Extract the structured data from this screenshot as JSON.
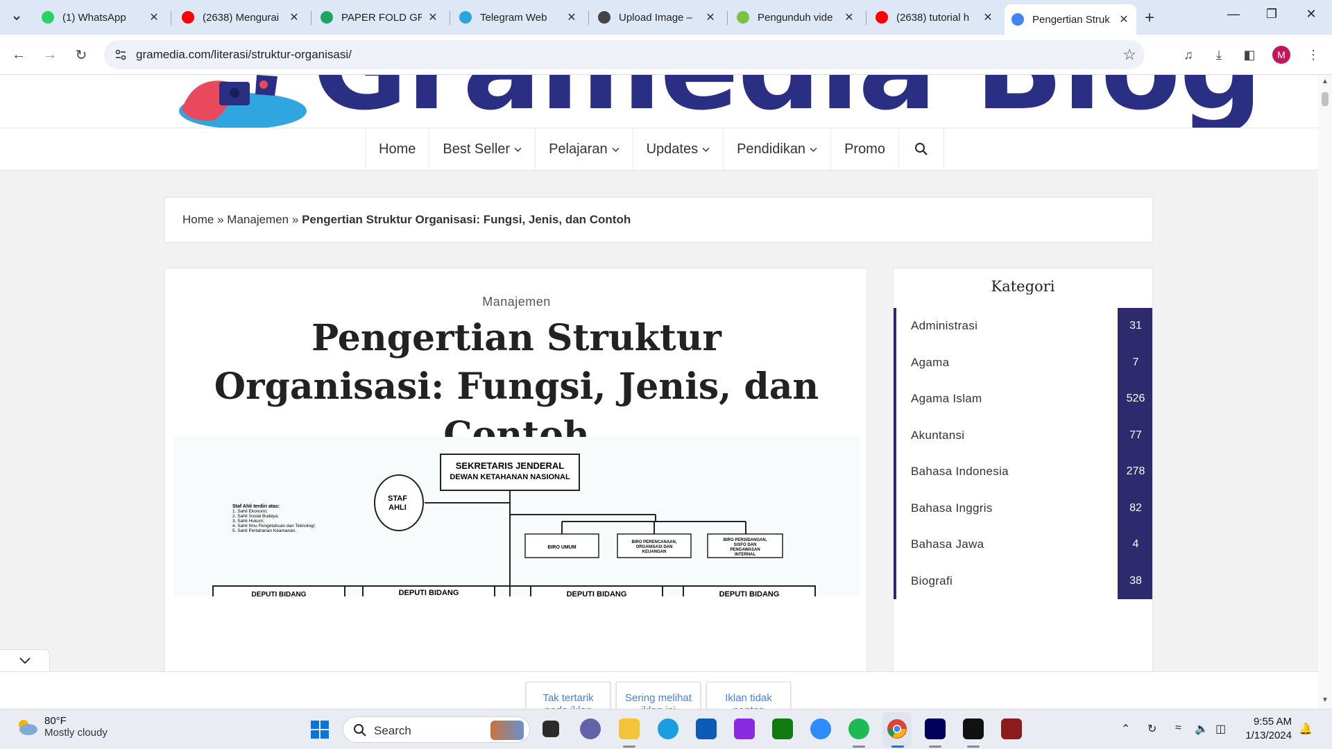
{
  "browser": {
    "tabs": [
      {
        "title": "(1) WhatsApp",
        "favicon": "whatsapp-icon",
        "color": "#25d366"
      },
      {
        "title": "(2638) Mengurai",
        "favicon": "youtube-icon",
        "color": "#ff0000"
      },
      {
        "title": "PAPER FOLD GRE",
        "favicon": "google-drive-icon",
        "color": "#1fa463"
      },
      {
        "title": "Telegram Web",
        "favicon": "telegram-icon",
        "color": "#2aa3df"
      },
      {
        "title": "Upload Image –",
        "favicon": "upload-icon",
        "color": "#444444"
      },
      {
        "title": "Pengunduh vide",
        "favicon": "download-arrow-icon",
        "color": "#7cc142"
      },
      {
        "title": "(2638) tutorial h",
        "favicon": "youtube-icon",
        "color": "#ff0000"
      },
      {
        "title": "Pengertian Struk",
        "favicon": "google-icon",
        "color": "#4285f4",
        "active": true
      }
    ],
    "url": "gramedia.com/literasi/struktur-organisasi/",
    "profile_initial": "M"
  },
  "site": {
    "logo_text": "Gramedia Blog",
    "nav": [
      {
        "label": "Home",
        "dropdown": false
      },
      {
        "label": "Best Seller",
        "dropdown": true
      },
      {
        "label": "Pelajaran",
        "dropdown": true
      },
      {
        "label": "Updates",
        "dropdown": true
      },
      {
        "label": "Pendidikan",
        "dropdown": true
      },
      {
        "label": "Promo",
        "dropdown": false
      }
    ],
    "breadcrumb": {
      "home": "Home",
      "sep": "»",
      "category": "Manajemen",
      "current": "Pengertian Struktur Organisasi: Fungsi, Jenis, dan Contoh"
    },
    "article": {
      "category": "Manajemen",
      "title": "Pengertian Struktur Organisasi: Fungsi, Jenis, dan Contoh",
      "orgchart": {
        "top": "SEKRETARIS JENDERAL\nDEWAN KETAHANAN NASIONAL",
        "staf": "STAF AHLI",
        "staf_list_title": "Staf Ahli terdiri atas:",
        "staf_list": [
          "Sahli Ekonomi;",
          "Sahli Sosial Budaya;",
          "Sahli Hukum;",
          "Sahli Ilmu Pengetahuan dan Teknologi;",
          "Sahli Pertahanan Keamanan."
        ],
        "biro": [
          "BIRO UMUM",
          "BIRO PERENCANAAN, ORGANISASI DAN KEUANGAN",
          "BIRO PERSIDANGAN, SISFO DAN PENGAWASAN INTERNAL"
        ],
        "deputi": [
          "DEPUTI BIDANG",
          "DEPUTI BIDANG",
          "DEPUTI BIDANG",
          "DEPUTI BIDANG"
        ]
      }
    },
    "sidebar": {
      "title": "Kategori",
      "categories": [
        {
          "name": "Administrasi",
          "count": "31"
        },
        {
          "name": "Agama",
          "count": "7"
        },
        {
          "name": "Agama Islam",
          "count": "526"
        },
        {
          "name": "Akuntansi",
          "count": "77"
        },
        {
          "name": "Bahasa Indonesia",
          "count": "278"
        },
        {
          "name": "Bahasa Inggris",
          "count": "82"
        },
        {
          "name": "Bahasa Jawa",
          "count": "4"
        },
        {
          "name": "Biografi",
          "count": "38"
        }
      ]
    },
    "ad_feedback": [
      "Tak tertarik pada iklan",
      "Sering melihat iklan ini",
      "Iklan tidak pantas"
    ]
  },
  "taskbar": {
    "weather_temp": "80°F",
    "weather_cond": "Mostly cloudy",
    "search_label": "Search",
    "time": "9:55 AM",
    "date": "1/13/2024"
  },
  "colors": {
    "brand": "#2b2f83",
    "sidebar_accent": "#2d2a6e",
    "ad_text": "#4a7fd9"
  }
}
